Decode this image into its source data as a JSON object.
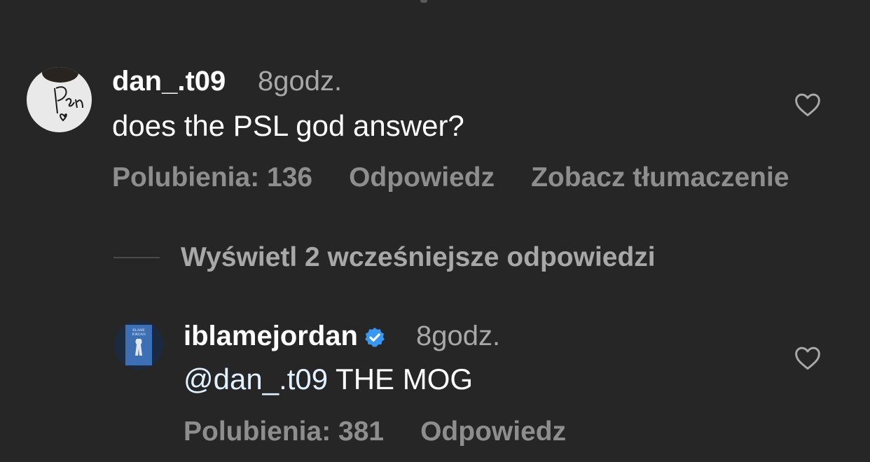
{
  "comments": [
    {
      "username": "dan_.t09",
      "time": "8godz.",
      "text": "does the PSL god answer?",
      "likes_label": "Polubienia: 136",
      "reply_label": "Odpowiedz",
      "translate_label": "Zobacz tłumaczenie",
      "avatar_icon": "signature-avatar",
      "like_icon": "heart-outline-icon"
    }
  ],
  "view_replies_label": "Wyświetl 2 wcześniejsze odpowiedzi",
  "reply": {
    "username": "iblamejordan",
    "verified_icon": "verified-badge-icon",
    "time": "8godz.",
    "mention": "@dan_.t09",
    "text": " THE MOG",
    "likes_label": "Polubienia: 381",
    "reply_label": "Odpowiedz",
    "avatar_icon": "book-cover-avatar",
    "like_icon": "heart-outline-icon"
  },
  "colors": {
    "background": "#262626",
    "primary_text": "#ffffff",
    "secondary_text": "#a8a8a8",
    "action_text": "#8e8e8e",
    "mention": "#e0f1ff",
    "verified": "#3897f0"
  }
}
